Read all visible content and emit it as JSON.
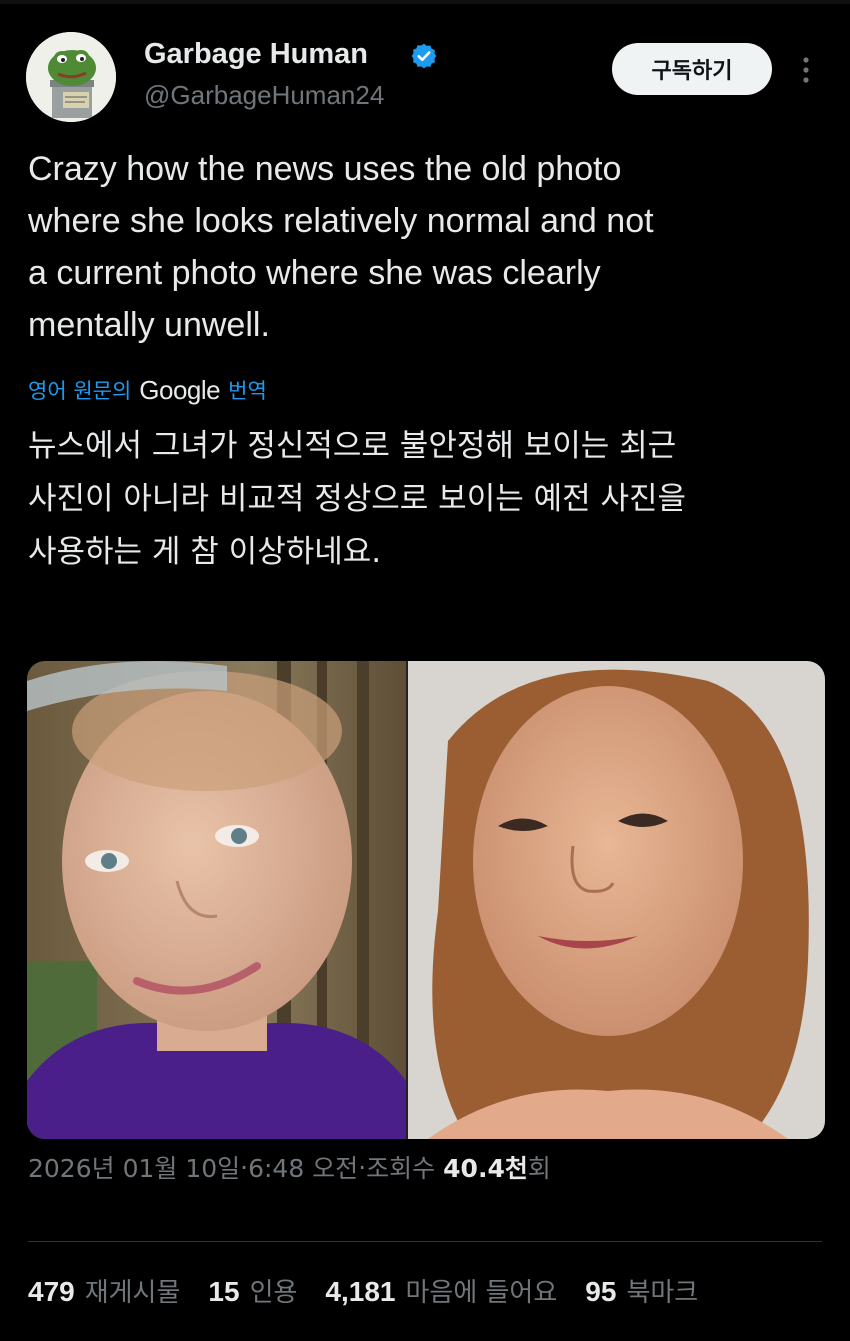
{
  "author": {
    "display_name": "Garbage Human",
    "handle": "@GarbageHuman24",
    "verified_icon": "verified-badge-icon",
    "avatar_icon": "frog-in-trash-can-avatar",
    "avatar_sign_text": "GARBAGE HUMAN"
  },
  "actions": {
    "subscribe_label": "구독하기",
    "more_icon": "more-vertical-icon"
  },
  "tweet": {
    "text_lines": [
      "Crazy how the news uses the old photo",
      "where she looks relatively normal and not",
      "a current photo where she was clearly",
      "mentally unwell."
    ],
    "translate": {
      "prefix": "영어 원문의",
      "provider": "Google",
      "suffix": "번역"
    },
    "translated_lines": [
      "뉴스에서 그녀가 정신적으로 불안정해 보이는 최근",
      "사진이 아니라 비교적 정상으로 보이는 예전 사진을",
      "사용하는 게 참 이상하네요."
    ]
  },
  "media": [
    {
      "name": "left-photo",
      "description_icon": "photo-short-hair-woman"
    },
    {
      "name": "right-photo",
      "description_icon": "photo-long-hair-woman"
    }
  ],
  "meta": {
    "date": "2026년 01월 10일",
    "sep1": " · ",
    "time": "6:48 오전",
    "sep2": " · ",
    "views_label": "조회수",
    "views_value": "40.4천",
    "views_unit": "회"
  },
  "stats": [
    {
      "num": "479",
      "label": "재게시물"
    },
    {
      "num": "15",
      "label": "인용"
    },
    {
      "num": "4,181",
      "label": "마음에 들어요"
    },
    {
      "num": "95",
      "label": "북마크"
    }
  ],
  "colors": {
    "background": "#000000",
    "text": "#e7e9ea",
    "secondary": "#71767b",
    "link": "#1d9bf0",
    "verified": "#1d9bf0",
    "divider": "#2f3336"
  }
}
